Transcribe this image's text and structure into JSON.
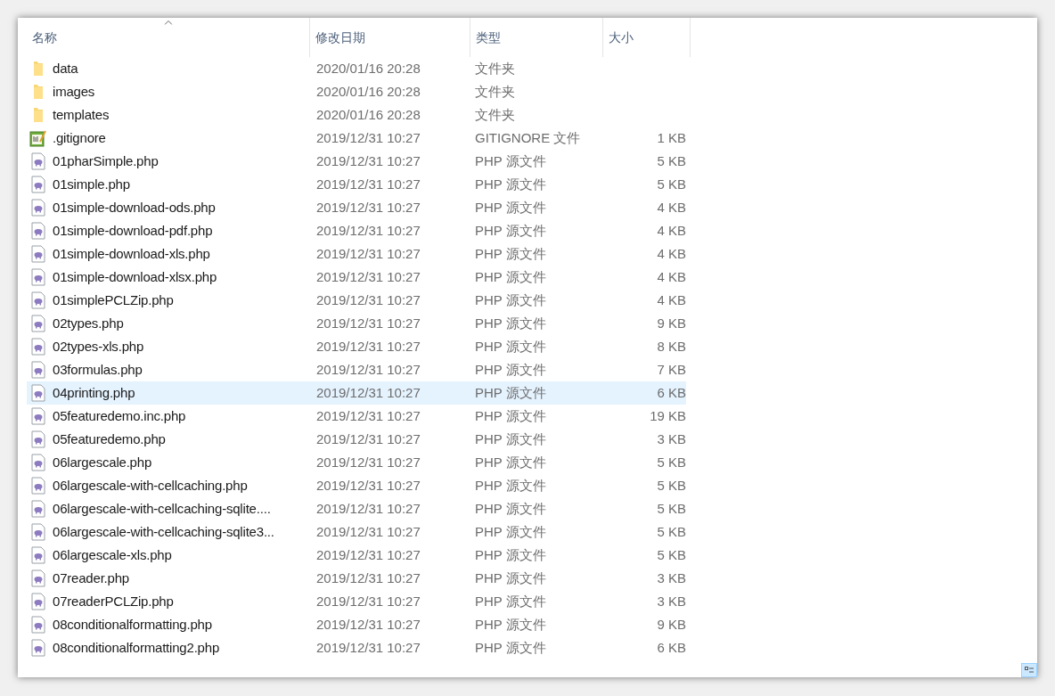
{
  "columns": [
    {
      "label": "名称",
      "sorted": true
    },
    {
      "label": "修改日期",
      "sorted": false
    },
    {
      "label": "类型",
      "sorted": false
    },
    {
      "label": "大小",
      "sorted": false
    }
  ],
  "rows": [
    {
      "kind": "folder",
      "name": "data",
      "date": "2020/01/16 20:28",
      "type": "文件夹",
      "selected": false
    },
    {
      "kind": "folder",
      "name": "images",
      "date": "2020/01/16 20:28",
      "type": "文件夹",
      "selected": false
    },
    {
      "kind": "folder",
      "name": "templates",
      "date": "2020/01/16 20:28",
      "type": "文件夹",
      "selected": false
    },
    {
      "kind": "text",
      "name": ".gitignore",
      "date": "2019/12/31 10:27",
      "type": "GITIGNORE 文件",
      "size": "1 KB",
      "selected": false
    },
    {
      "kind": "php",
      "name": "01pharSimple.php",
      "date": "2019/12/31 10:27",
      "type": "PHP 源文件",
      "size": "5 KB",
      "selected": false
    },
    {
      "kind": "php",
      "name": "01simple.php",
      "date": "2019/12/31 10:27",
      "type": "PHP 源文件",
      "size": "5 KB",
      "selected": false
    },
    {
      "kind": "php",
      "name": "01simple-download-ods.php",
      "date": "2019/12/31 10:27",
      "type": "PHP 源文件",
      "size": "4 KB",
      "selected": false
    },
    {
      "kind": "php",
      "name": "01simple-download-pdf.php",
      "date": "2019/12/31 10:27",
      "type": "PHP 源文件",
      "size": "4 KB",
      "selected": false
    },
    {
      "kind": "php",
      "name": "01simple-download-xls.php",
      "date": "2019/12/31 10:27",
      "type": "PHP 源文件",
      "size": "4 KB",
      "selected": false
    },
    {
      "kind": "php",
      "name": "01simple-download-xlsx.php",
      "date": "2019/12/31 10:27",
      "type": "PHP 源文件",
      "size": "4 KB",
      "selected": false
    },
    {
      "kind": "php",
      "name": "01simplePCLZip.php",
      "date": "2019/12/31 10:27",
      "type": "PHP 源文件",
      "size": "4 KB",
      "selected": false
    },
    {
      "kind": "php",
      "name": "02types.php",
      "date": "2019/12/31 10:27",
      "type": "PHP 源文件",
      "size": "9 KB",
      "selected": false
    },
    {
      "kind": "php",
      "name": "02types-xls.php",
      "date": "2019/12/31 10:27",
      "type": "PHP 源文件",
      "size": "8 KB",
      "selected": false
    },
    {
      "kind": "php",
      "name": "03formulas.php",
      "date": "2019/12/31 10:27",
      "type": "PHP 源文件",
      "size": "7 KB",
      "selected": false
    },
    {
      "kind": "php",
      "name": "04printing.php",
      "date": "2019/12/31 10:27",
      "type": "PHP 源文件",
      "size": "6 KB",
      "selected": true
    },
    {
      "kind": "php",
      "name": "05featuredemo.inc.php",
      "date": "2019/12/31 10:27",
      "type": "PHP 源文件",
      "size": "19 KB",
      "selected": false
    },
    {
      "kind": "php",
      "name": "05featuredemo.php",
      "date": "2019/12/31 10:27",
      "type": "PHP 源文件",
      "size": "3 KB",
      "selected": false
    },
    {
      "kind": "php",
      "name": "06largescale.php",
      "date": "2019/12/31 10:27",
      "type": "PHP 源文件",
      "size": "5 KB",
      "selected": false
    },
    {
      "kind": "php",
      "name": "06largescale-with-cellcaching.php",
      "date": "2019/12/31 10:27",
      "type": "PHP 源文件",
      "size": "5 KB",
      "selected": false
    },
    {
      "kind": "php",
      "name": "06largescale-with-cellcaching-sqlite....",
      "date": "2019/12/31 10:27",
      "type": "PHP 源文件",
      "size": "5 KB",
      "selected": false
    },
    {
      "kind": "php",
      "name": "06largescale-with-cellcaching-sqlite3...",
      "date": "2019/12/31 10:27",
      "type": "PHP 源文件",
      "size": "5 KB",
      "selected": false
    },
    {
      "kind": "php",
      "name": "06largescale-xls.php",
      "date": "2019/12/31 10:27",
      "type": "PHP 源文件",
      "size": "5 KB",
      "selected": false
    },
    {
      "kind": "php",
      "name": "07reader.php",
      "date": "2019/12/31 10:27",
      "type": "PHP 源文件",
      "size": "3 KB",
      "selected": false
    },
    {
      "kind": "php",
      "name": "07readerPCLZip.php",
      "date": "2019/12/31 10:27",
      "type": "PHP 源文件",
      "size": "3 KB",
      "selected": false
    },
    {
      "kind": "php",
      "name": "08conditionalformatting.php",
      "date": "2019/12/31 10:27",
      "type": "PHP 源文件",
      "size": "9 KB",
      "selected": false
    },
    {
      "kind": "php",
      "name": "08conditionalformatting2.php",
      "date": "2019/12/31 10:27",
      "type": "PHP 源文件",
      "size": "6 KB",
      "selected": false
    }
  ]
}
